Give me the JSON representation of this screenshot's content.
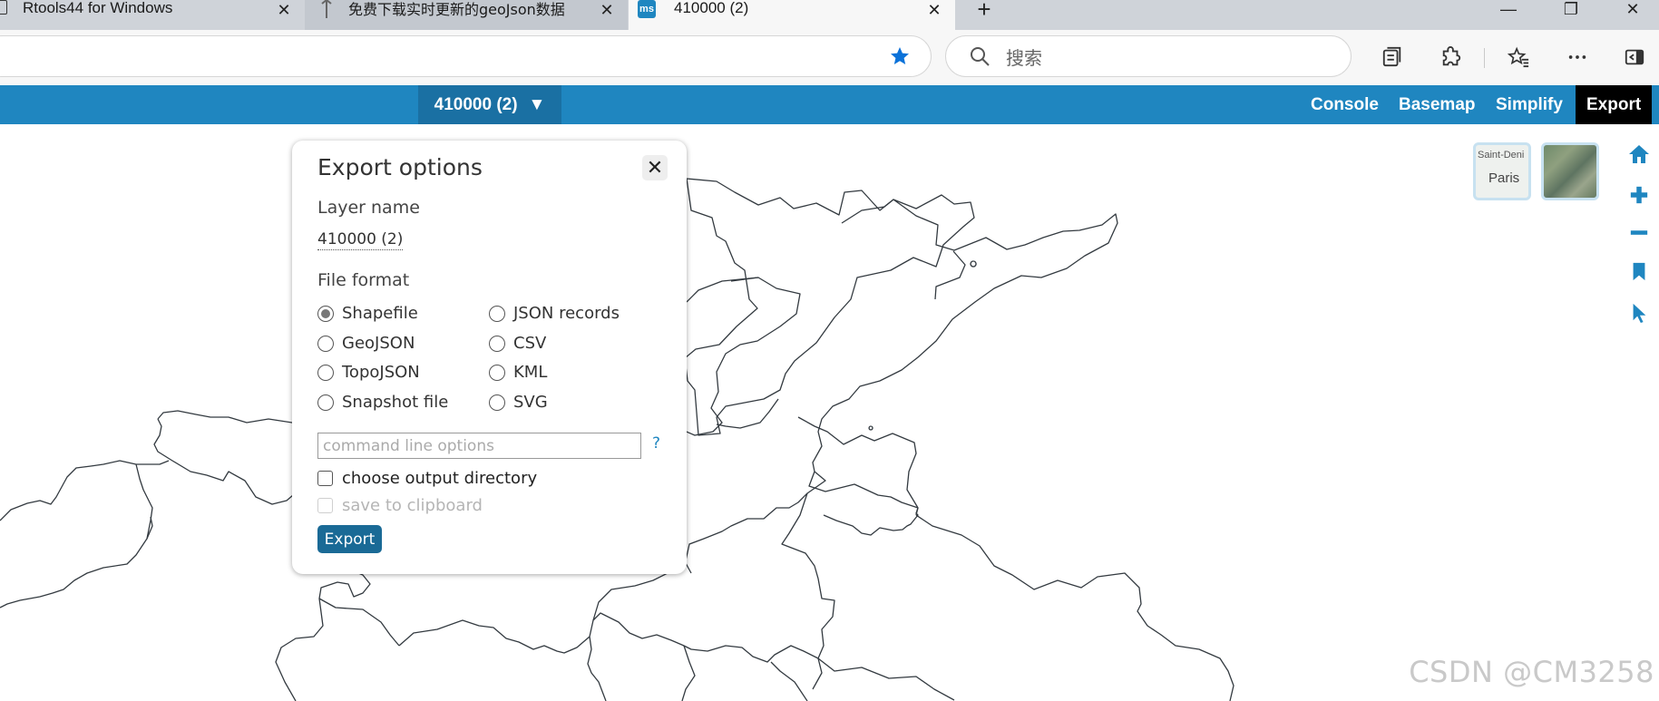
{
  "browser": {
    "tabs": [
      {
        "title": "Rtools44 for Windows",
        "close": "✕"
      },
      {
        "title": "免费下载实时更新的geoJson数据",
        "close": "✕"
      },
      {
        "title": "410000 (2)",
        "close": "✕"
      }
    ],
    "new_tab": "+",
    "window_controls": {
      "minimize": "—",
      "restore": "❐",
      "close": "✕"
    },
    "search_placeholder": "搜索",
    "accent_color": "#0b72d9"
  },
  "app": {
    "layer_menu": {
      "label": "410000 (2)",
      "arrow": "▼"
    },
    "nav": [
      "Console",
      "Basemap",
      "Simplify",
      "Export"
    ],
    "active_nav": "Export",
    "header_color": "#1f86c0"
  },
  "basemaps": {
    "streets": {
      "label_top": "Saint-Deni",
      "label": "Paris"
    }
  },
  "map_tools": [
    "home-icon",
    "zoom-in-icon",
    "zoom-out-icon",
    "bookmark-icon",
    "pointer-icon"
  ],
  "dialog": {
    "title": "Export options",
    "close": "✕",
    "layer_name_label": "Layer name",
    "layer_name_value": "410000 (2)",
    "file_format_label": "File format",
    "formats": [
      {
        "label": "Shapefile",
        "checked": true
      },
      {
        "label": "JSON records",
        "checked": false
      },
      {
        "label": "GeoJSON",
        "checked": false
      },
      {
        "label": "CSV",
        "checked": false
      },
      {
        "label": "TopoJSON",
        "checked": false
      },
      {
        "label": "KML",
        "checked": false
      },
      {
        "label": "Snapshot file",
        "checked": false
      },
      {
        "label": "SVG",
        "checked": false
      }
    ],
    "command_placeholder": "command line options",
    "help": "?",
    "choose_dir_label": "choose output directory",
    "clipboard_label": "save to clipboard",
    "export_button": "Export"
  },
  "watermark": "CSDN @CM3258"
}
